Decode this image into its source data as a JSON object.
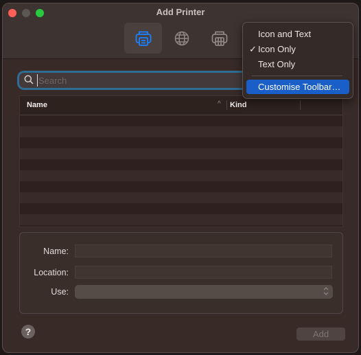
{
  "window": {
    "title": "Add Printer",
    "traffic_lights": {
      "close": "#fe5f57",
      "minimize": "#5c5654",
      "maximize": "#29c840"
    }
  },
  "toolbar": {
    "items": [
      {
        "name": "default-printers",
        "icon": "printer-icon",
        "active": true,
        "color": "#1e7cf0"
      },
      {
        "name": "ip-printers",
        "icon": "globe-icon",
        "active": false
      },
      {
        "name": "windows-printers",
        "icon": "printer-server-icon",
        "active": false
      }
    ]
  },
  "context_menu": {
    "items": [
      {
        "label": "Icon and Text",
        "checked": false
      },
      {
        "label": "Icon Only",
        "checked": true
      },
      {
        "label": "Text Only",
        "checked": false
      },
      {
        "label": "Customise Toolbar…",
        "highlighted": true
      }
    ],
    "checkmark": "✓"
  },
  "search": {
    "value": "",
    "placeholder": "Search"
  },
  "printer_table": {
    "columns": [
      {
        "label": "Name",
        "sort": "ascending"
      },
      {
        "label": "Kind"
      }
    ],
    "rows": []
  },
  "form": {
    "name_label": "Name:",
    "name_value": "",
    "location_label": "Location:",
    "location_value": "",
    "use_label": "Use:",
    "use_value": ""
  },
  "footer": {
    "help_label": "?",
    "add_label": "Add",
    "add_enabled": false
  }
}
